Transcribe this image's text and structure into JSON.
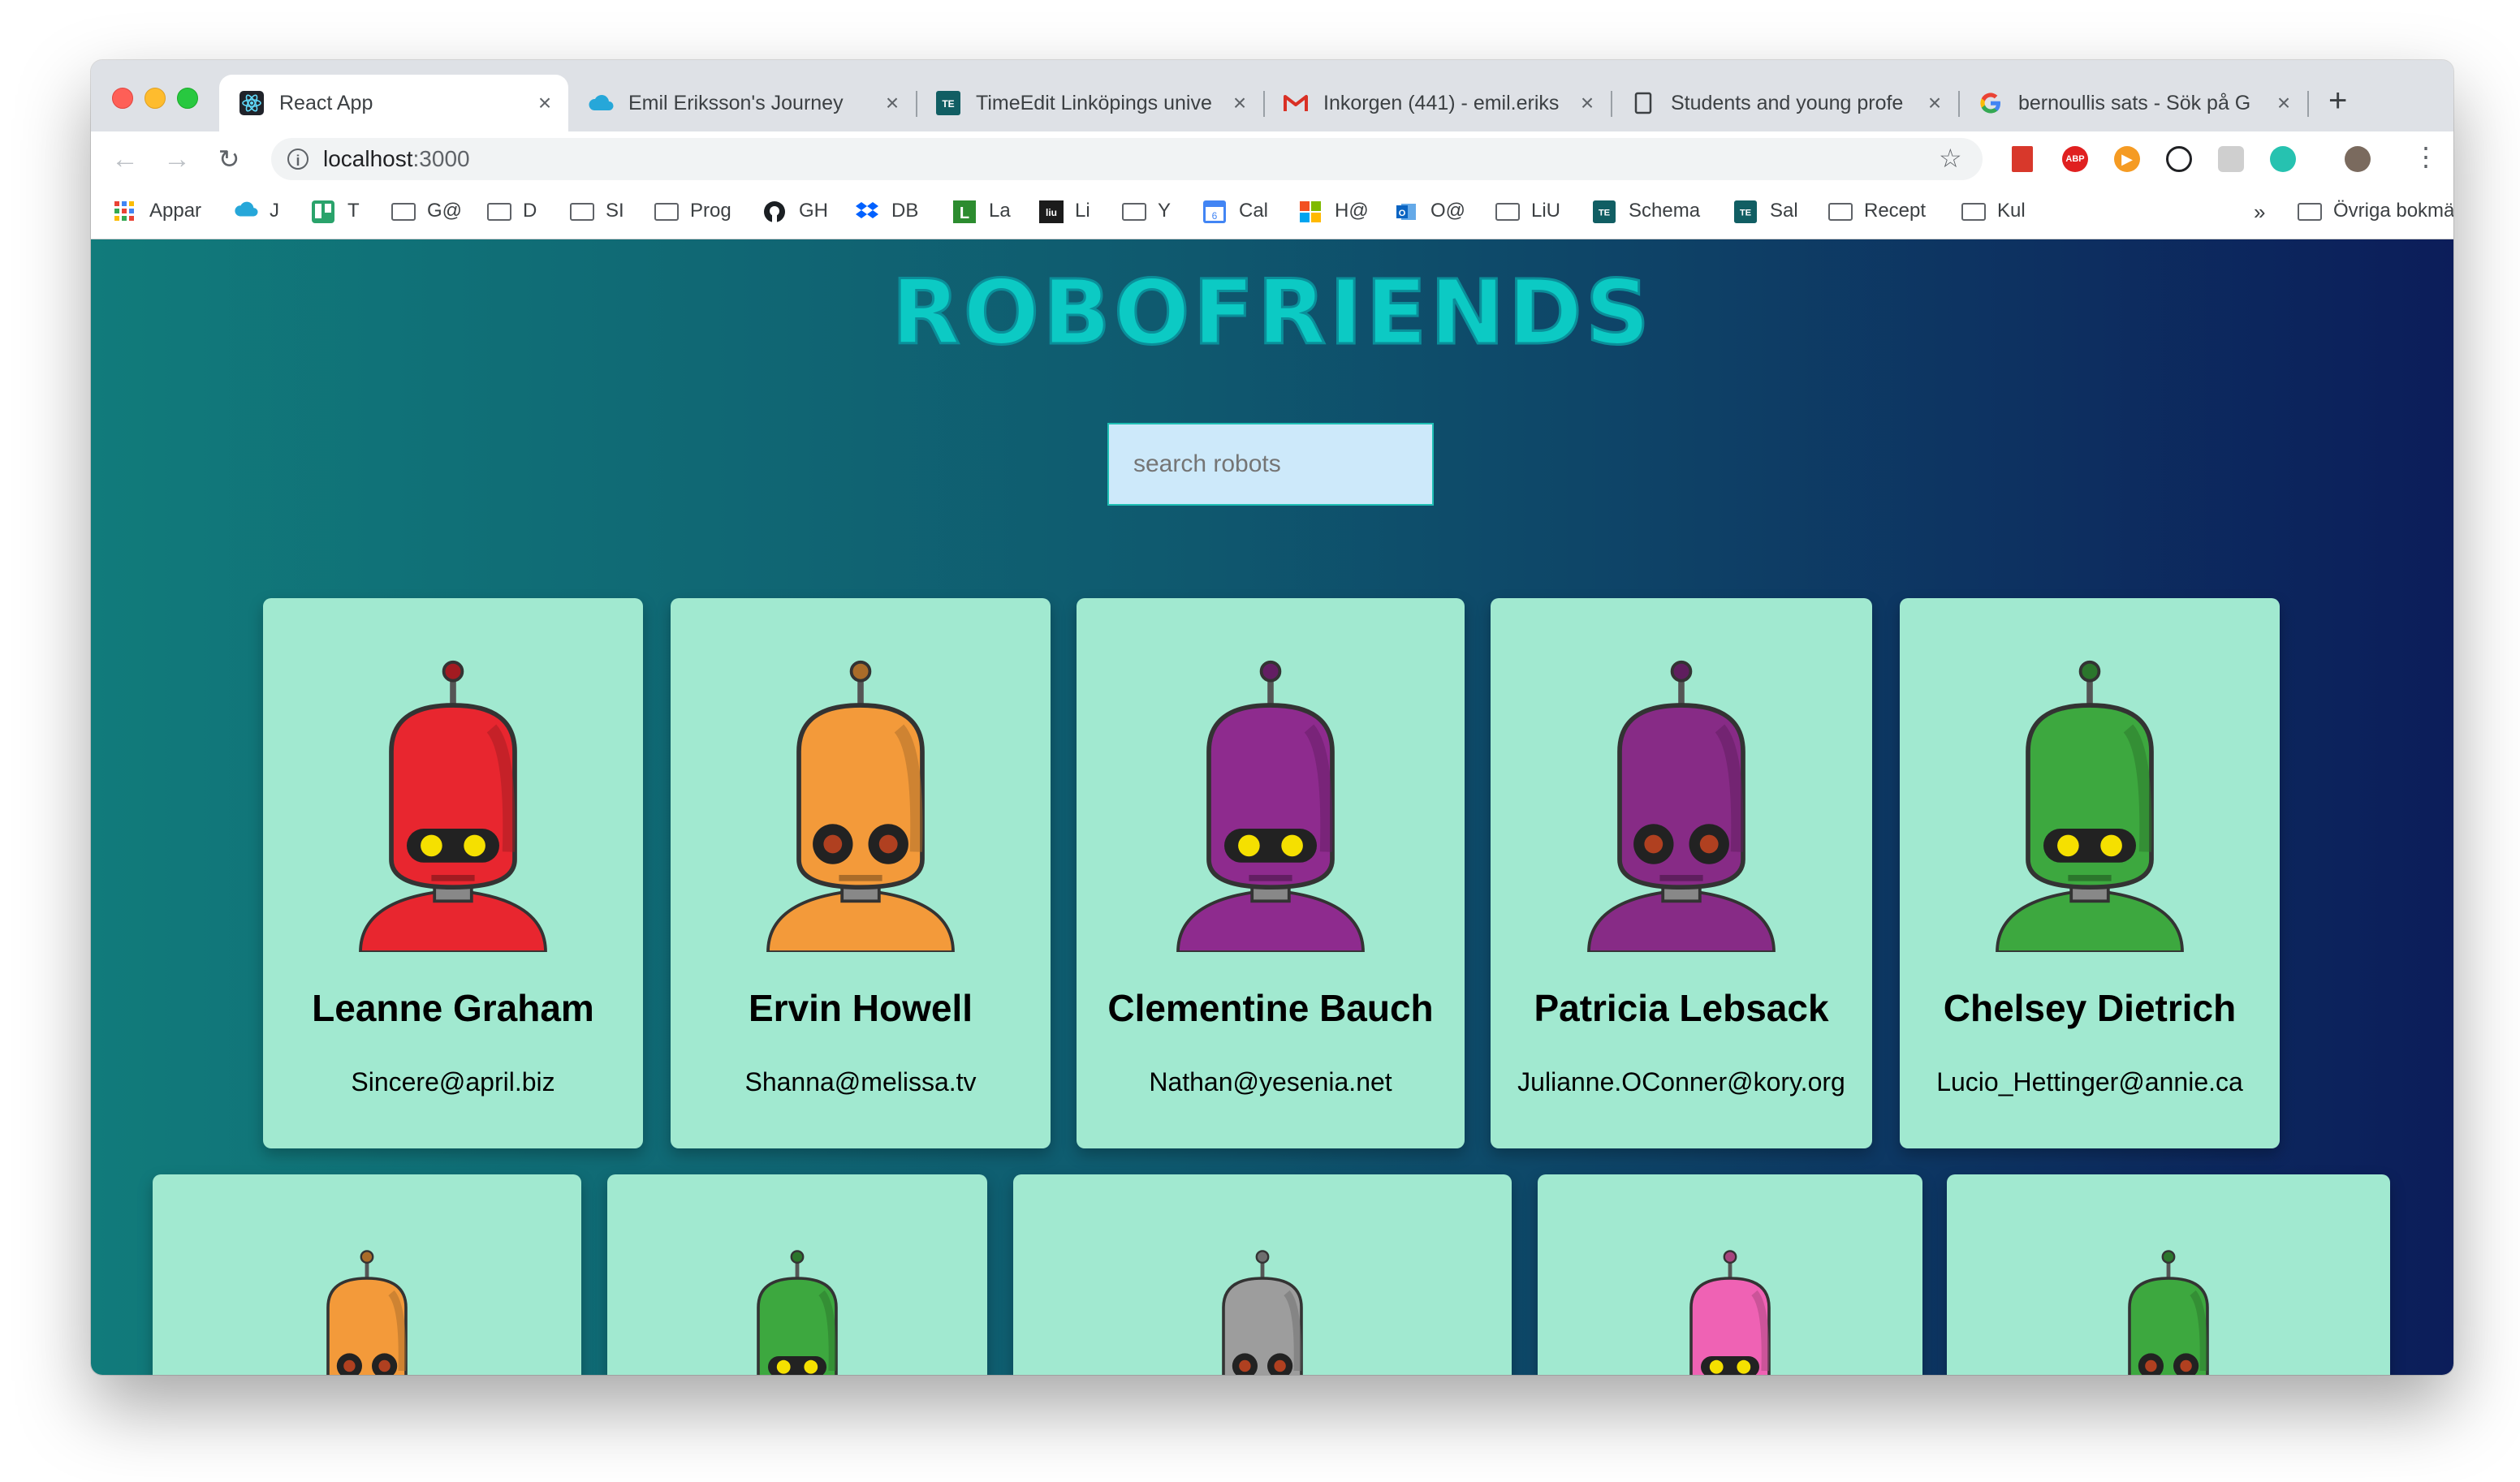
{
  "browser": {
    "tabs": [
      {
        "title": "React App",
        "icon": "react-icon",
        "active": true
      },
      {
        "title": "Emil Eriksson's Journey",
        "icon": "cloud-icon"
      },
      {
        "title": "TimeEdit Linköpings unive",
        "icon": "timeedit-icon"
      },
      {
        "title": "Inkorgen (441) - emil.eriks",
        "icon": "gmail-icon"
      },
      {
        "title": "Students and young profe",
        "icon": "doc-icon"
      },
      {
        "title": "bernoullis sats - Sök på G",
        "icon": "google-icon"
      }
    ],
    "url_host": "localhost",
    "url_port": ":3000",
    "bookmarks": [
      {
        "label": "Appar",
        "icon": "apps-grid-icon"
      },
      {
        "label": "J",
        "icon": "cloud-icon"
      },
      {
        "label": "T",
        "icon": "trello-icon"
      },
      {
        "label": "G@",
        "icon": "folder-icon"
      },
      {
        "label": "D",
        "icon": "folder-icon"
      },
      {
        "label": "SI",
        "icon": "folder-icon"
      },
      {
        "label": "Prog",
        "icon": "folder-icon"
      },
      {
        "label": "GH",
        "icon": "github-icon"
      },
      {
        "label": "DB",
        "icon": "dropbox-icon"
      },
      {
        "label": "La",
        "icon": "l-icon"
      },
      {
        "label": "Li",
        "icon": "liu-icon"
      },
      {
        "label": "Y",
        "icon": "folder-icon"
      },
      {
        "label": "Cal",
        "icon": "calendar-icon"
      },
      {
        "label": "H@",
        "icon": "microsoft-icon"
      },
      {
        "label": "O@",
        "icon": "outlook-icon"
      },
      {
        "label": "LiU",
        "icon": "folder-icon"
      },
      {
        "label": "Schema",
        "icon": "timeedit-icon"
      },
      {
        "label": "Sal",
        "icon": "timeedit-icon"
      },
      {
        "label": "Recept",
        "icon": "folder-icon"
      },
      {
        "label": "Kul",
        "icon": "folder-icon"
      }
    ],
    "overflow_chevron": "»",
    "other_bookmarks": "Övriga bokmärken"
  },
  "app": {
    "title": "ROBOFRIENDS",
    "search_placeholder": "search robots"
  },
  "robots": [
    {
      "name": "Leanne Graham",
      "email": "Sincere@april.biz",
      "color": "#e8262f"
    },
    {
      "name": "Ervin Howell",
      "email": "Shanna@melissa.tv",
      "color": "#f39a3a"
    },
    {
      "name": "Clementine Bauch",
      "email": "Nathan@yesenia.net",
      "color": "#8e2b8e"
    },
    {
      "name": "Patricia Lebsack",
      "email": "Julianne.OConner@kory.org",
      "color": "#872b86"
    },
    {
      "name": "Chelsey Dietrich",
      "email": "Lucio_Hettinger@annie.ca",
      "color": "#3da83f"
    },
    {
      "name": "",
      "email": "",
      "color": "#f39a3a"
    },
    {
      "name": "",
      "email": "",
      "color": "#3da83f"
    },
    {
      "name": "",
      "email": "",
      "color": "#9d9d9d"
    },
    {
      "name": "",
      "email": "",
      "color": "#ef62b4"
    },
    {
      "name": "",
      "email": "",
      "color": "#3da83f"
    }
  ]
}
